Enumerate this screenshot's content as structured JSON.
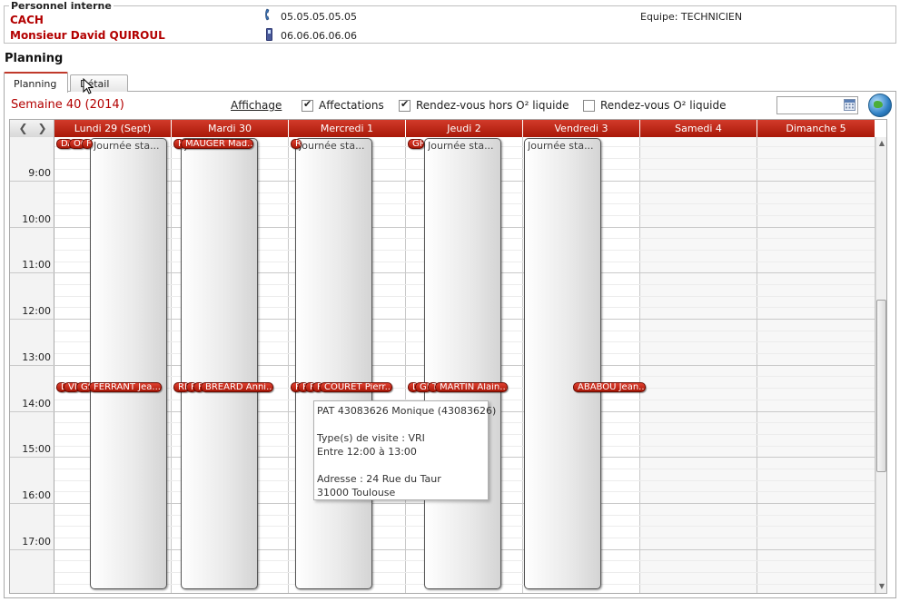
{
  "header": {
    "legend": "Personnel interne",
    "company": "CACH",
    "person": "Monsieur David QUIROUL",
    "phone": "05.05.05.05.05",
    "mobile": "06.06.06.06.06",
    "equipe": "Equipe: TECHNICIEN"
  },
  "section_title": "Planning",
  "tabs": [
    {
      "label": "Planning",
      "active": true
    },
    {
      "label": "Détail",
      "active": false
    }
  ],
  "toolbar": {
    "semaine": "Semaine 40 (2014)",
    "affichage": "Affichage",
    "checkboxes": [
      {
        "label": "Affectations",
        "checked": true
      },
      {
        "label": "Rendez-vous hors O² liquide",
        "checked": true
      },
      {
        "label": "Rendez-vous O² liquide",
        "checked": false
      }
    ],
    "date_value": ""
  },
  "calendar": {
    "days": [
      "Lundi 29 (Sept)",
      "Mardi 30",
      "Mercredi 1",
      "Jeudi 2",
      "Vendredi 3",
      "Samedi 4",
      "Dimanche 5"
    ],
    "hours": [
      "9:00",
      "10:00",
      "11:00",
      "12:00",
      "13:00",
      "14:00",
      "15:00",
      "16:00",
      "17:00"
    ],
    "event_label": "Journée sta...",
    "top_pills": [
      {
        "day": 0,
        "texts": [
          "DA",
          "OG",
          "F"
        ]
      },
      {
        "day": 1,
        "texts": [
          "H",
          "MAUGER Mad..."
        ]
      },
      {
        "day": 2,
        "texts": [
          "R"
        ]
      },
      {
        "day": 3,
        "texts": [
          "GR"
        ]
      }
    ],
    "mid_pills": [
      {
        "day": 0,
        "texts": [
          "D",
          "VI",
          "GS",
          "FERRANT Jea..."
        ]
      },
      {
        "day": 1,
        "texts": [
          "RE",
          "F",
          "F",
          "BREARD Anni..."
        ]
      },
      {
        "day": 2,
        "texts": [
          "F",
          "F",
          "F",
          "F",
          "COURET Pierr..."
        ]
      },
      {
        "day": 3,
        "texts": [
          "D",
          "GR",
          "T",
          "MARTIN Alain..."
        ]
      },
      {
        "day": 4,
        "texts": [
          "ABABOU Jean..."
        ]
      }
    ],
    "tooltip": [
      "PAT 43083626 Monique (43083626)",
      "",
      "Type(s) de visite : VRI",
      "Entre 12:00 à 13:00",
      "",
      "Adresse : 24 Rue du Taur",
      "31000 Toulouse"
    ]
  },
  "colors": {
    "accent": "#b30000",
    "day_header": "#c0392b"
  }
}
